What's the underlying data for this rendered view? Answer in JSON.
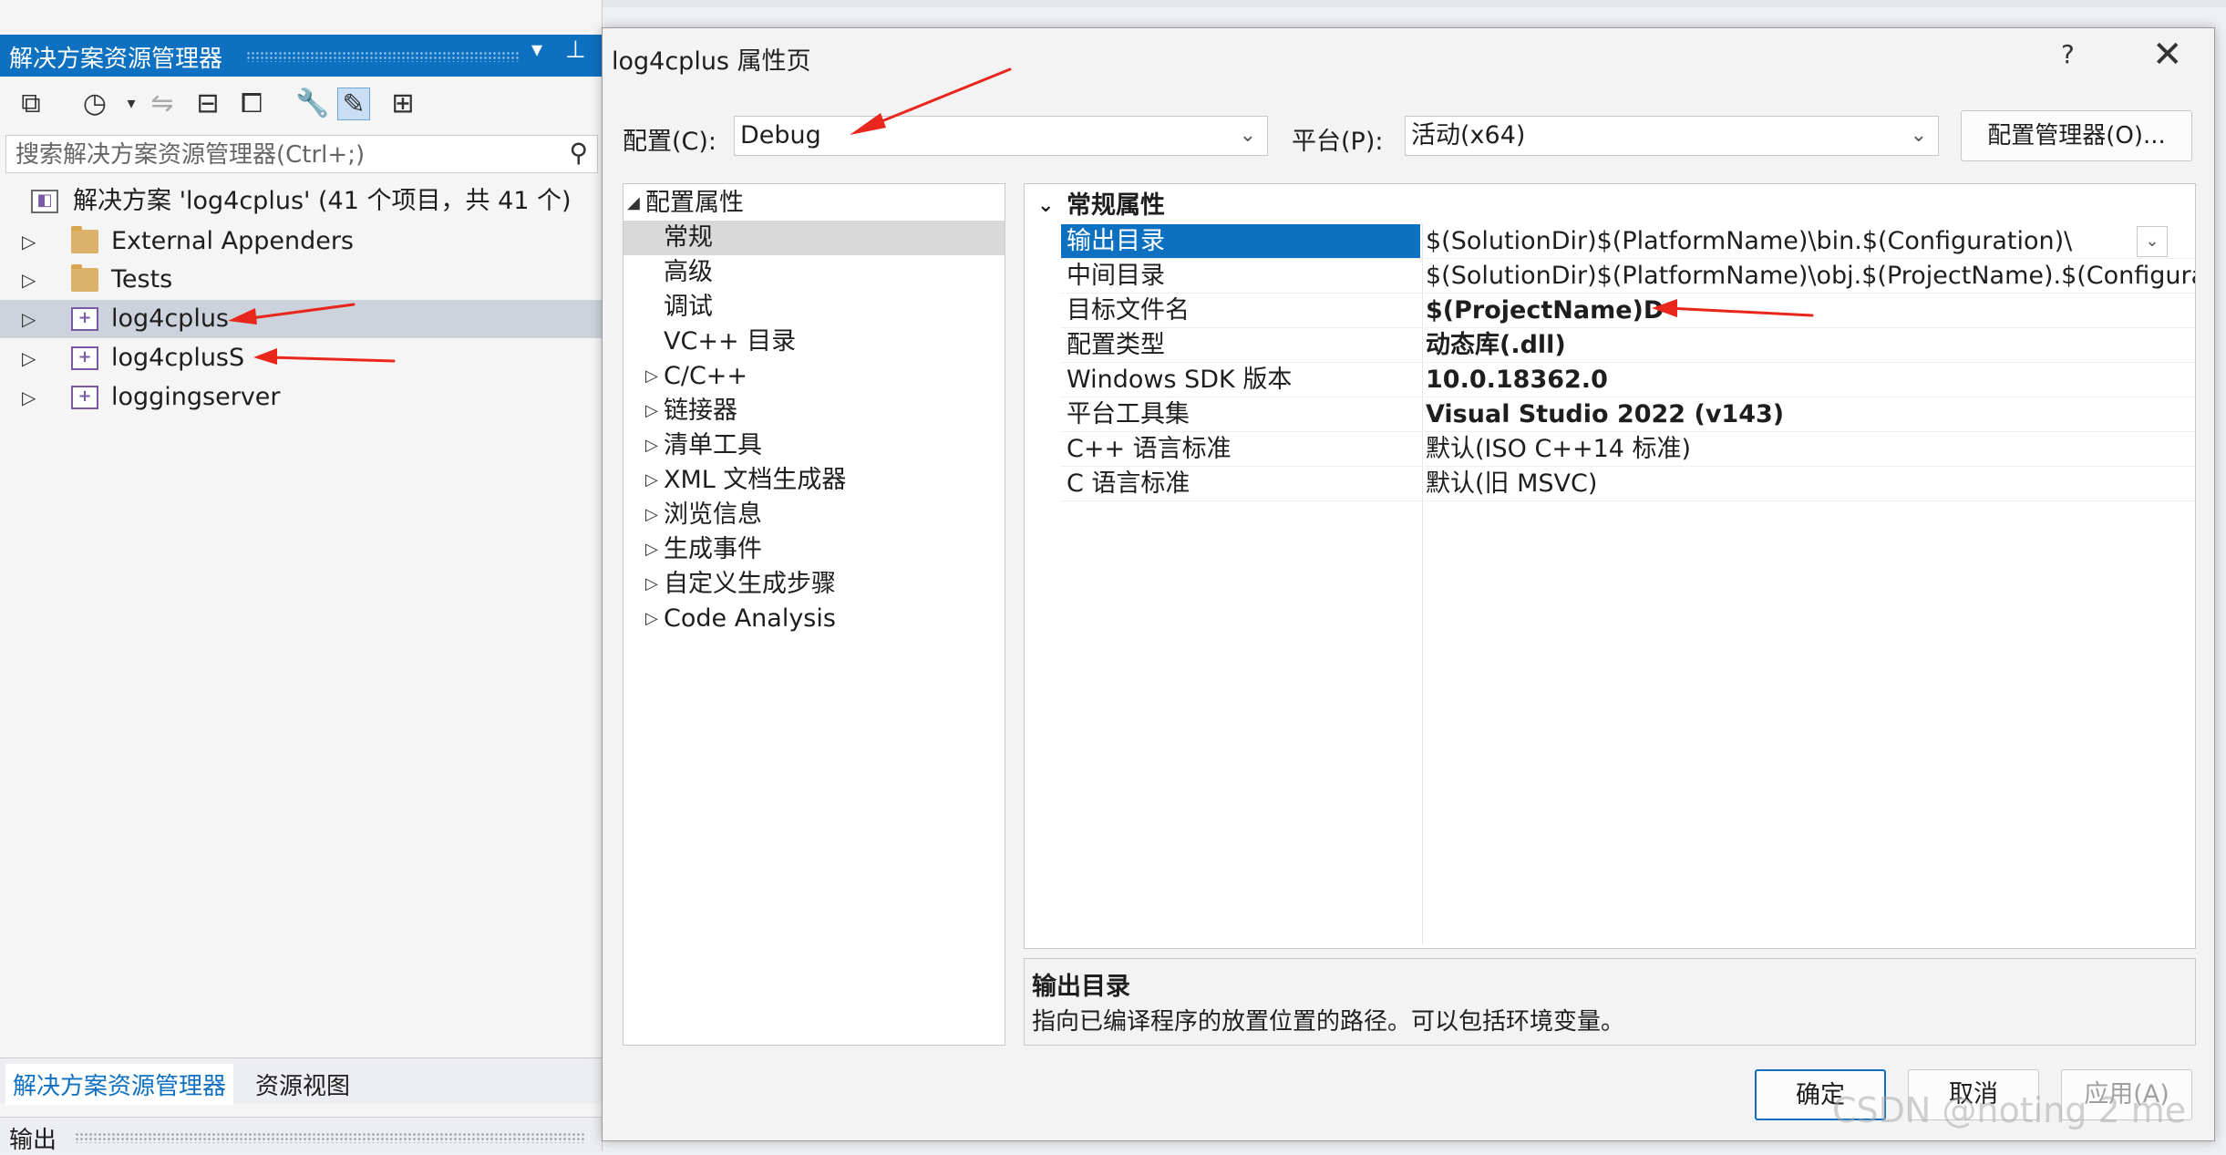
{
  "solution_explorer": {
    "title": "解决方案资源管理器",
    "search_placeholder": "搜索解决方案资源管理器(Ctrl+;)",
    "solution_label": "解决方案 'log4cplus' (41 个项目，共 41 个)",
    "items": [
      {
        "label": "External Appenders",
        "type": "folder"
      },
      {
        "label": "Tests",
        "type": "folder"
      },
      {
        "label": "log4cplus",
        "type": "project",
        "selected": true
      },
      {
        "label": "log4cplusS",
        "type": "project"
      },
      {
        "label": "loggingserver",
        "type": "project"
      }
    ],
    "tabs": [
      "解决方案资源管理器",
      "资源视图"
    ],
    "output_label": "输出"
  },
  "dialog": {
    "title": "log4cplus 属性页",
    "help": "?",
    "close": "✕",
    "config_label": "配置(C):",
    "config_value": "Debug",
    "platform_label": "平台(P):",
    "platform_value": "活动(x64)",
    "config_manager": "配置管理器(O)...",
    "nav": [
      {
        "label": "配置属性",
        "expander": "◢",
        "indent": 0
      },
      {
        "label": "常规",
        "indent": 1,
        "selected": true
      },
      {
        "label": "高级",
        "indent": 1
      },
      {
        "label": "调试",
        "indent": 1
      },
      {
        "label": "VC++ 目录",
        "indent": 1
      },
      {
        "label": "C/C++",
        "expander": "▷",
        "indent": 1
      },
      {
        "label": "链接器",
        "expander": "▷",
        "indent": 1
      },
      {
        "label": "清单工具",
        "expander": "▷",
        "indent": 1
      },
      {
        "label": "XML 文档生成器",
        "expander": "▷",
        "indent": 1
      },
      {
        "label": "浏览信息",
        "expander": "▷",
        "indent": 1
      },
      {
        "label": "生成事件",
        "expander": "▷",
        "indent": 1
      },
      {
        "label": "自定义生成步骤",
        "expander": "▷",
        "indent": 1
      },
      {
        "label": "Code Analysis",
        "expander": "▷",
        "indent": 1
      }
    ],
    "category": "常规属性",
    "properties": [
      {
        "name": "输出目录",
        "value": "$(SolutionDir)$(PlatformName)\\bin.$(Configuration)\\",
        "bold": false,
        "selected": true
      },
      {
        "name": "中间目录",
        "value": "$(SolutionDir)$(PlatformName)\\obj.$(ProjectName).$(Configurati",
        "bold": false
      },
      {
        "name": "目标文件名",
        "value": "$(ProjectName)D",
        "bold": true
      },
      {
        "name": "配置类型",
        "value": "动态库(.dll)",
        "bold": true
      },
      {
        "name": "Windows SDK 版本",
        "value": "10.0.18362.0",
        "bold": true
      },
      {
        "name": "平台工具集",
        "value": "Visual Studio 2022 (v143)",
        "bold": true
      },
      {
        "name": "C++ 语言标准",
        "value": "默认(ISO C++14 标准)",
        "bold": false
      },
      {
        "name": "C 语言标准",
        "value": "默认(旧 MSVC)",
        "bold": false
      }
    ],
    "description_title": "输出目录",
    "description_text": "指向已编译程序的放置位置的路径。可以包括环境变量。",
    "buttons": {
      "ok": "确定",
      "cancel": "取消",
      "apply": "应用(A)"
    }
  },
  "watermark": "CSDN @noting 2 me",
  "colors": {
    "accent": "#0e70c0",
    "annotation_arrow": "#e8261c"
  }
}
